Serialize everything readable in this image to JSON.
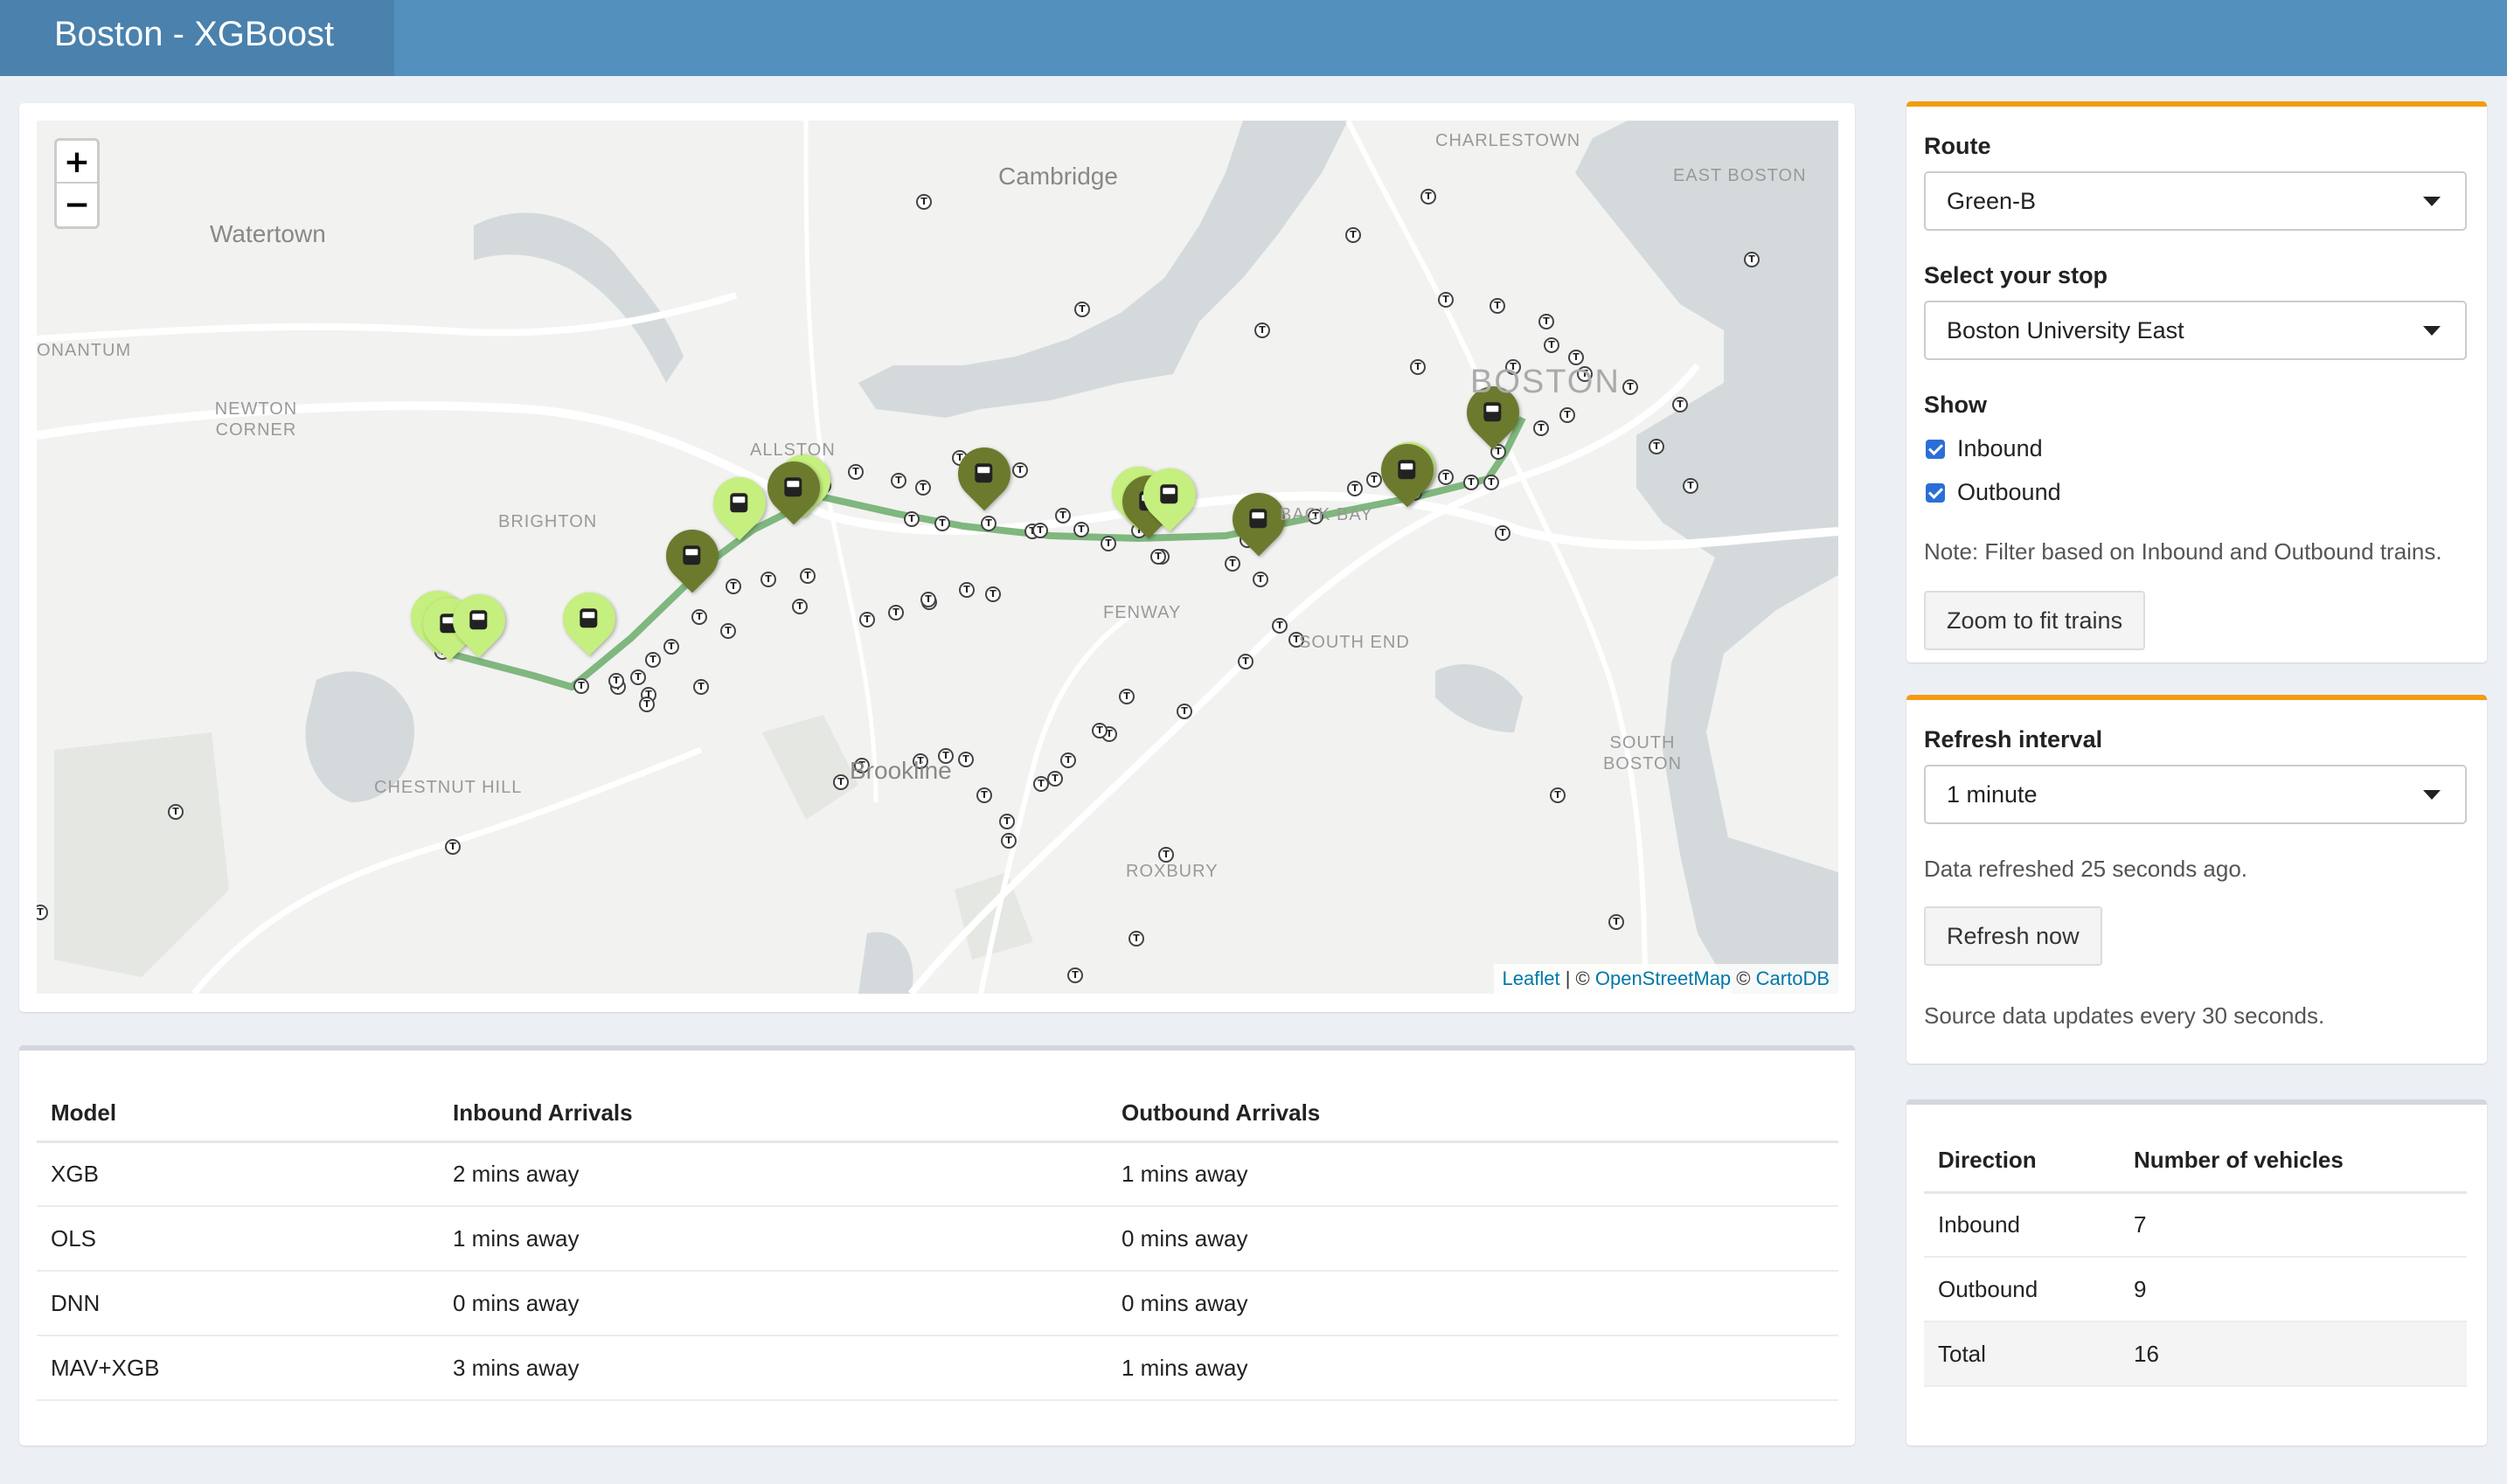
{
  "header": {
    "title": "Boston - XGBoost"
  },
  "map": {
    "zoom_in": "+",
    "zoom_out": "−",
    "labels": [
      "Cambridge",
      "Watertown",
      "CHARLESTOWN",
      "EAST BOSTON",
      "ONANTUM",
      "NEWTON CORNER",
      "BOSTON",
      "BRIGHTON",
      "ALLSTON",
      "FENWAY",
      "BACK BAY",
      "SOUTH END",
      "Brookline",
      "CHESTNUT HILL",
      "SOUTH BOSTON",
      "ROXBURY"
    ],
    "attribution": {
      "leaflet": "Leaflet",
      "sep1": "| ©",
      "osm": "OpenStreetMap",
      "sep2": "©",
      "carto": "CartoDB"
    }
  },
  "arrivals": {
    "headers": [
      "Model",
      "Inbound Arrivals",
      "Outbound Arrivals"
    ],
    "rows": [
      [
        "XGB",
        "2 mins away",
        "1 mins away"
      ],
      [
        "OLS",
        "1 mins away",
        "0 mins away"
      ],
      [
        "DNN",
        "0 mins away",
        "0 mins away"
      ],
      [
        "MAV+XGB",
        "3 mins away",
        "1 mins away"
      ]
    ]
  },
  "controls": {
    "route_label": "Route",
    "route_value": "Green-B",
    "stop_label": "Select your stop",
    "stop_value": "Boston University East",
    "show_label": "Show",
    "inbound_label": "Inbound",
    "outbound_label": "Outbound",
    "note": "Note: Filter based on Inbound and Outbound trains.",
    "zoom_button": "Zoom to fit trains"
  },
  "refresh": {
    "label": "Refresh interval",
    "value": "1 minute",
    "status": "Data refreshed 25 seconds ago.",
    "button": "Refresh now",
    "source_note": "Source data updates every 30 seconds."
  },
  "counts": {
    "headers": [
      "Direction",
      "Number of vehicles"
    ],
    "rows": [
      [
        "Inbound",
        "7"
      ],
      [
        "Outbound",
        "9"
      ],
      [
        "Total",
        "16"
      ]
    ]
  },
  "colors": {
    "header": "#5390bd",
    "brand": "#4a81ad",
    "accent": "#f39c12",
    "inbound_marker": "#c5ef7e",
    "outbound_marker": "#6c7a2e",
    "route_line": "#7fb77e"
  }
}
